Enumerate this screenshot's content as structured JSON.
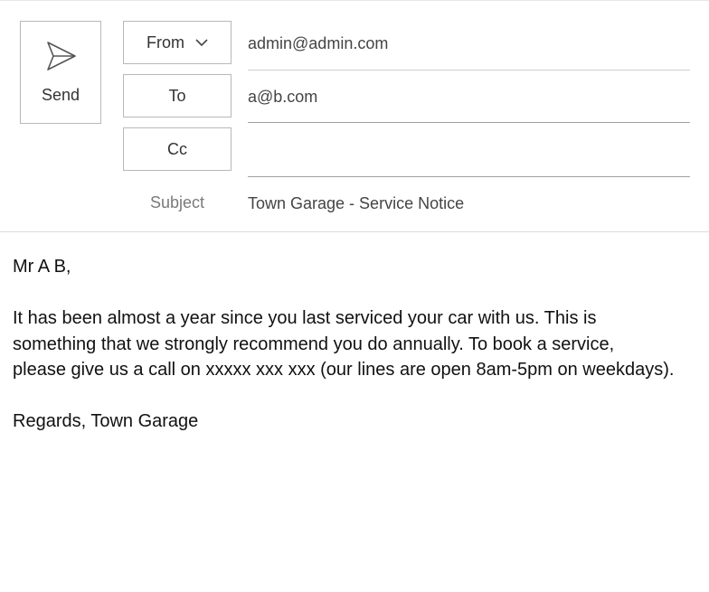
{
  "toolbar": {
    "send_label": "Send",
    "send_icon": "send-icon"
  },
  "header": {
    "from_label": "From",
    "to_label": "To",
    "cc_label": "Cc",
    "subject_label": "Subject",
    "from_value": "admin@admin.com",
    "to_value": "a@b.com",
    "cc_value": "",
    "subject_value": "Town Garage - Service Notice"
  },
  "message": {
    "salutation": "Mr A B,",
    "paragraph_line1": "It has been almost a year since you last serviced your car with us.  This is",
    "paragraph_line2": "something that we strongly recommend you do annually.  To book a service,",
    "paragraph_line3": "please give us a call on xxxxx xxx xxx (our lines are open 8am-5pm on weekdays).",
    "signoff": "Regards, Town Garage"
  }
}
